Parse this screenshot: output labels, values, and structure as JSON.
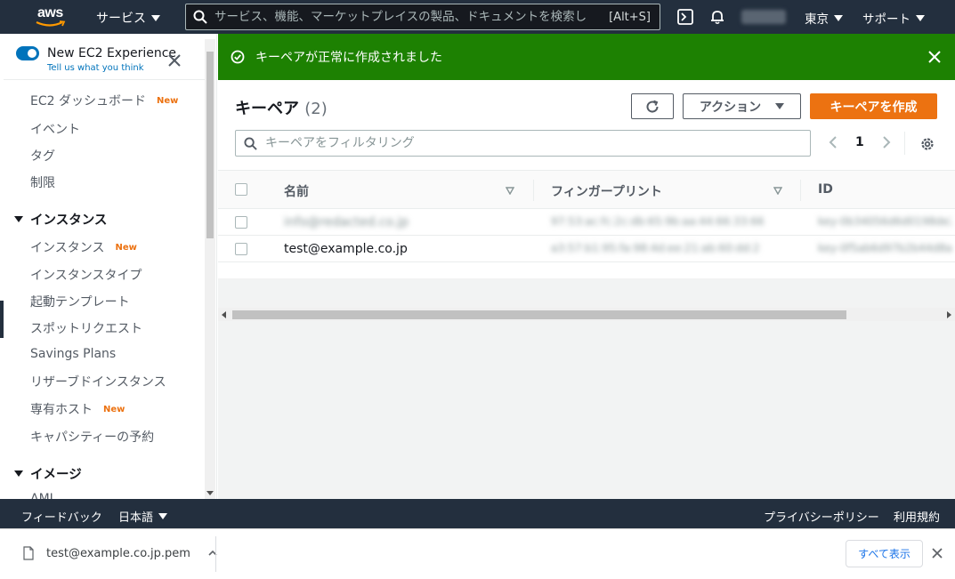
{
  "topnav": {
    "logo": "aws",
    "services_label": "サービス",
    "search_placeholder": "サービス、機能、マーケットプレイスの製品、ドキュメントを検索し",
    "search_shortcut": "[Alt+S]",
    "region_label": "東京",
    "support_label": "サポート",
    "icons": [
      "cloudshell-icon",
      "bell-icon"
    ]
  },
  "sidebar": {
    "experience_title": "New EC2 Experience",
    "experience_link": "Tell us what you think",
    "items": [
      {
        "label": "EC2 ダッシュボード",
        "badge": "New"
      },
      {
        "label": "イベント",
        "badge": ""
      },
      {
        "label": "タグ",
        "badge": ""
      },
      {
        "label": "制限",
        "badge": ""
      }
    ],
    "sections": [
      {
        "title": "インスタンス",
        "items": [
          {
            "label": "インスタンス",
            "badge": "New"
          },
          {
            "label": "インスタンスタイプ",
            "badge": ""
          },
          {
            "label": "起動テンプレート",
            "badge": ""
          },
          {
            "label": "スポットリクエスト",
            "badge": ""
          },
          {
            "label": "Savings Plans",
            "badge": ""
          },
          {
            "label": "リザーブドインスタンス",
            "badge": ""
          },
          {
            "label": "専有ホスト",
            "badge": "New"
          },
          {
            "label": "キャパシティーの予約",
            "badge": ""
          }
        ]
      },
      {
        "title": "イメージ",
        "items": [
          {
            "label": "AMI",
            "badge": ""
          }
        ]
      }
    ]
  },
  "flash": {
    "message": "キーペアが正常に作成されました",
    "status_color": "#1d8102"
  },
  "keypairs": {
    "title": "キーペア",
    "count": "(2)",
    "action_label": "アクション",
    "create_label": "キーペアを作成",
    "filter_placeholder": "キーペアをフィルタリング",
    "page": "1",
    "columns": [
      "名前",
      "フィンガープリント",
      "ID"
    ],
    "rows": [
      {
        "name": "info@redacted.co.jp",
        "fingerprint": "97:53:ac:fc:2c:db:65:9b:aa:44:66:33:66",
        "id": "key-0b34056d6d0198de2",
        "redacted": true
      },
      {
        "name": "test@example.co.jp",
        "fingerprint": "a3:57:b1:95:fa:98:4d:ee:21:ab:60:dd:2",
        "id": "key-0f5ab6d97b2b44d8a",
        "redacted": false
      }
    ]
  },
  "footer": {
    "feedback": "フィードバック",
    "language": "日本語",
    "privacy": "プライバシーポリシー",
    "terms": "利用規約"
  },
  "download_bar": {
    "filename": "test@example.co.jp.pem",
    "show_all": "すべて表示"
  },
  "colors": {
    "nav_bg": "#232f3e",
    "accent_orange": "#ec7211",
    "link_blue": "#0073bb",
    "success_green": "#1d8102"
  }
}
